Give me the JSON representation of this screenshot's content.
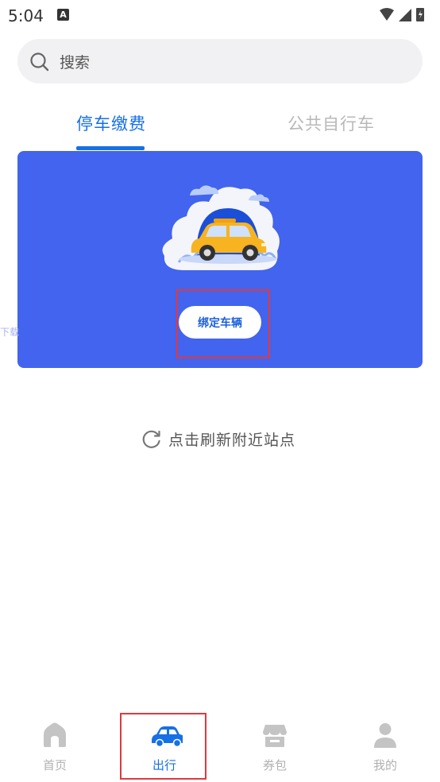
{
  "status_bar": {
    "time": "5:04",
    "notification_letter": "A"
  },
  "search": {
    "placeholder": "搜索"
  },
  "tabs": [
    {
      "label": "停车缴费",
      "active": true
    },
    {
      "label": "公共自行车",
      "active": false
    }
  ],
  "banner": {
    "button_label": "绑定车辆",
    "edge_text": "下载"
  },
  "refresh": {
    "label": "点击刷新附近站点"
  },
  "bottom_nav": [
    {
      "label": "首页",
      "icon": "home-icon",
      "active": false
    },
    {
      "label": "出行",
      "icon": "car-icon",
      "active": true
    },
    {
      "label": "券包",
      "icon": "store-icon",
      "active": false
    },
    {
      "label": "我的",
      "icon": "user-icon",
      "active": false
    }
  ],
  "colors": {
    "accent": "#1670e6",
    "banner": "#4264ee",
    "highlight": "#e0393e",
    "inactive": "#b0b0b0"
  }
}
